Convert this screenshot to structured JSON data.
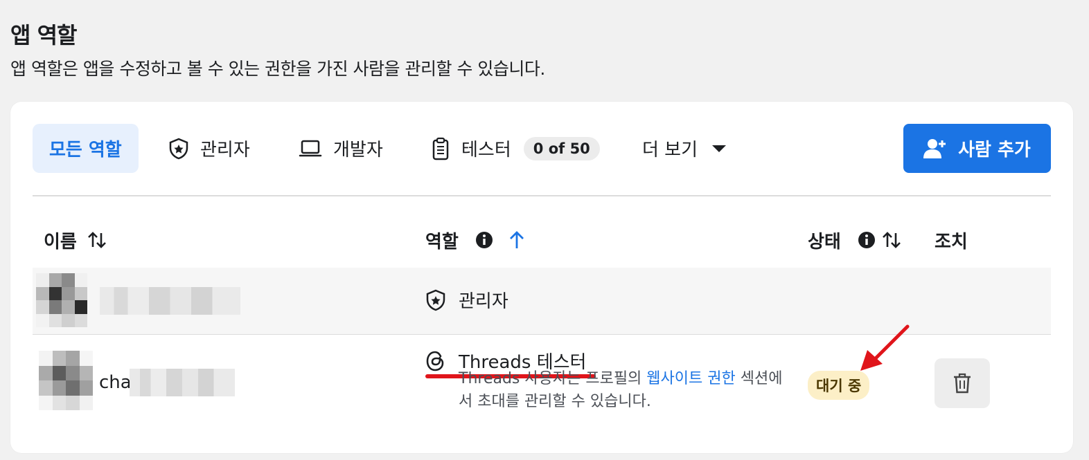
{
  "page": {
    "title": "앱 역할",
    "description": "앱 역할은 앱을 수정하고 볼 수 있는 권한을 가진 사람을 관리할 수 있습니다."
  },
  "tabs": [
    {
      "label": "모든 역할",
      "active": true,
      "icon": "none"
    },
    {
      "label": "관리자",
      "icon": "shield-star-icon"
    },
    {
      "label": "개발자",
      "icon": "laptop-icon"
    },
    {
      "label": "테스터",
      "icon": "clipboard-icon",
      "badge": "0 of 50"
    },
    {
      "label": "더 보기",
      "icon": "caret-down-icon"
    }
  ],
  "add_button": {
    "label": "사람 추가",
    "icon": "person-add-icon"
  },
  "table": {
    "columns": [
      {
        "label": "이름",
        "icon": "sort-icon"
      },
      {
        "label": "역할",
        "icons": [
          "info-icon",
          "sort-ascending-icon"
        ]
      },
      {
        "label": "상태",
        "icons": [
          "info-icon",
          "sort-icon"
        ]
      },
      {
        "label": "조치"
      }
    ],
    "rows": [
      {
        "name": "",
        "role": "관리자",
        "role_icon": "shield-star-icon",
        "status": ""
      },
      {
        "name": "cha",
        "role": "Threads 테스터",
        "role_icon": "threads-icon",
        "role_desc_before": "Threads 사용자는 프로필의 ",
        "role_desc_link": "웹사이트 권한",
        "role_desc_after": " 섹션에서 초대를 관리할 수 있습니다.",
        "status": "대기 중",
        "action_icon": "trash-icon"
      }
    ]
  },
  "colors": {
    "accent": "#1b74e4",
    "active_tab_bg": "#e7f0fd",
    "status_pending_bg": "#fcefc7",
    "annotation_red": "#e0151b"
  }
}
